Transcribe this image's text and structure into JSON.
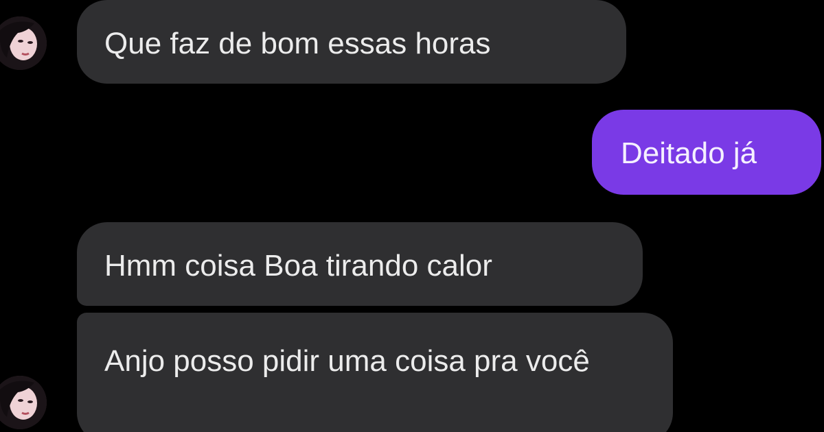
{
  "messages": [
    {
      "text": "Que faz de bom essas horas",
      "direction": "incoming"
    },
    {
      "text": "Deitado já",
      "direction": "outgoing"
    },
    {
      "text": "Hmm coisa Boa tirando calor",
      "direction": "incoming"
    },
    {
      "text": "Anjo posso pidir uma coisa pra você",
      "direction": "incoming"
    }
  ],
  "colors": {
    "background": "#000000",
    "incoming_bubble": "#2f2f31",
    "outgoing_bubble": "#7a3ae6"
  },
  "icons": {
    "avatar": "contact-avatar-icon"
  }
}
